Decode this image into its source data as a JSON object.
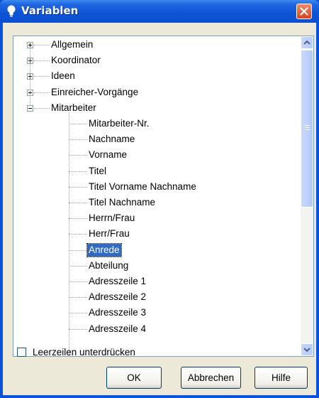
{
  "window": {
    "title": "Variablen"
  },
  "tree": {
    "top_items": [
      "Allgemein",
      "Koordinator",
      "Ideen",
      "Einreicher-Vorgänge",
      "Mitarbeiter"
    ],
    "children": [
      "Mitarbeiter-Nr.",
      "Nachname",
      "Vorname",
      "Titel",
      "Titel Vorname Nachname",
      "Titel Nachname",
      "Herrn/Frau",
      "Herr/Frau",
      "Anrede",
      "Abteilung",
      "Adresszeile 1",
      "Adresszeile 2",
      "Adresszeile 3",
      "Adresszeile 4"
    ],
    "selected": "Anrede"
  },
  "options": {
    "suppress_blank_lines": "Leerzeilen unterdrücken",
    "suppress_checked": false
  },
  "buttons": {
    "ok": "OK",
    "cancel": "Abbrechen",
    "help": "Hilfe"
  }
}
